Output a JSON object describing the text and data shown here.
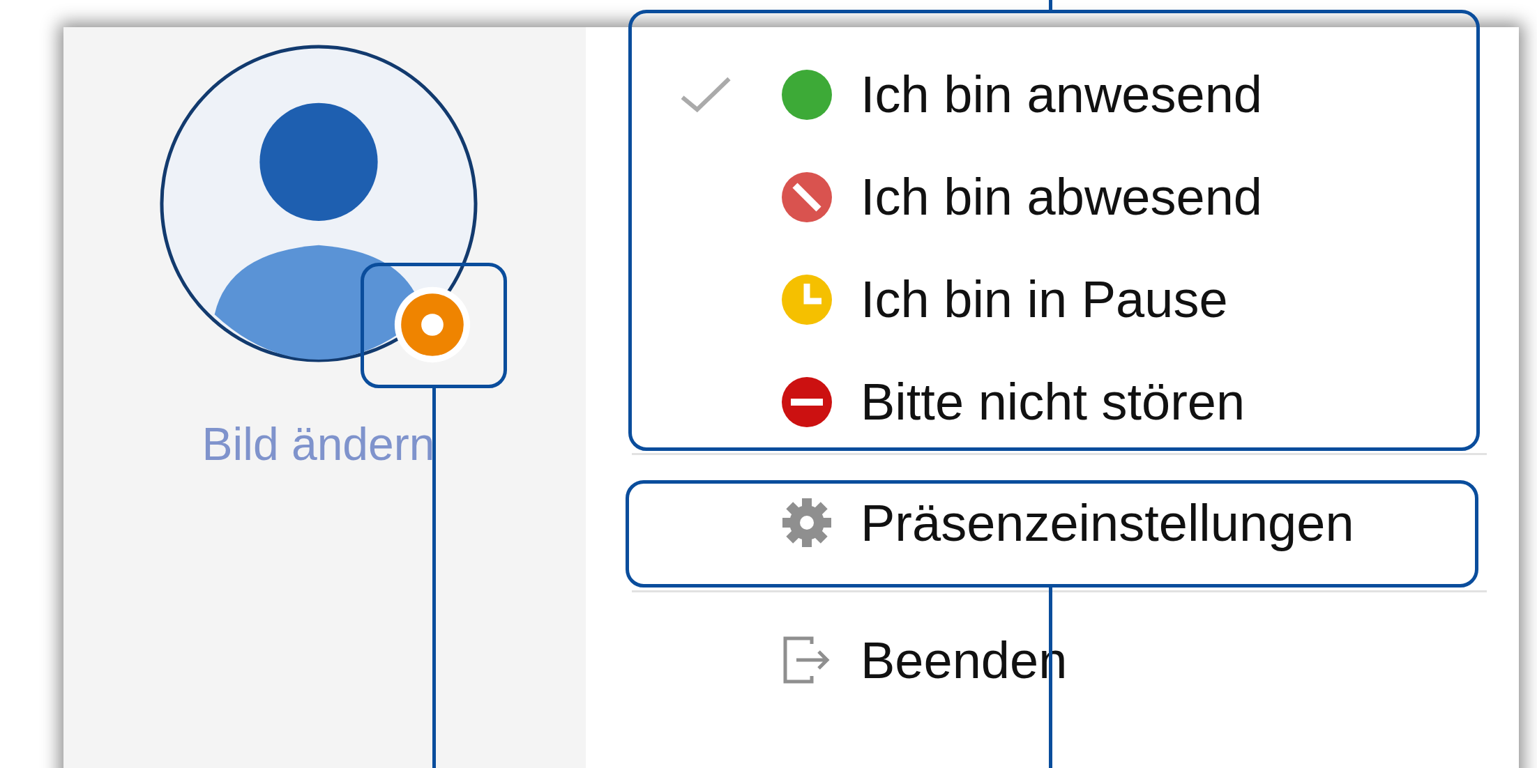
{
  "profile": {
    "change_picture_link": "Bild ändern"
  },
  "status_options": [
    {
      "label": "Ich bin anwesend",
      "kind": "available",
      "color": "#3daa37",
      "selected": true
    },
    {
      "label": "Ich bin abwesend",
      "kind": "away",
      "color": "#d9534f",
      "selected": false
    },
    {
      "label": "Ich bin in Pause",
      "kind": "break",
      "color": "#f5c000",
      "selected": false
    },
    {
      "label": "Bitte nicht stören",
      "kind": "dnd",
      "color": "#cc1111",
      "selected": false
    }
  ],
  "menu_items": [
    {
      "label": "Präsenzeinstellungen",
      "kind": "settings"
    },
    {
      "label": "Beenden",
      "kind": "exit"
    }
  ]
}
